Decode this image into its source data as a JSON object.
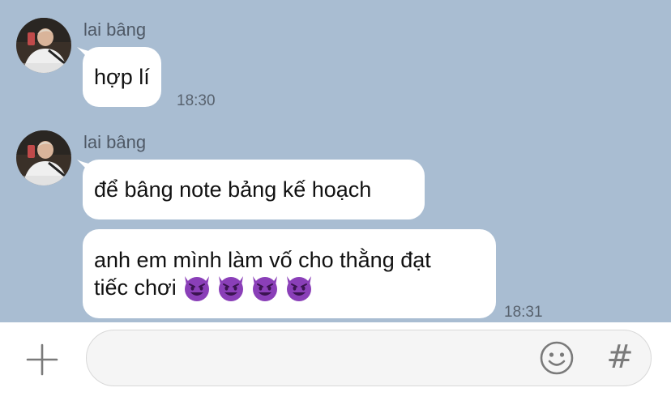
{
  "messages": [
    {
      "sender": "lai bâng",
      "avatar_icon": "user-photo-avatar",
      "bubbles": [
        {
          "text": "hợp lí",
          "time": "18:30"
        }
      ]
    },
    {
      "sender": "lai bâng",
      "avatar_icon": "user-photo-avatar",
      "bubbles": [
        {
          "text": "để bâng note bảng kế hoạch"
        },
        {
          "line1": "anh em mình làm vố cho thằng đạt",
          "line2": "tiếc chơi",
          "emoji": "smiling-devil-emoji",
          "emoji_count": 4,
          "time": "18:31"
        }
      ]
    }
  ],
  "composer": {
    "input_value": "",
    "input_placeholder": "",
    "plus_icon": "plus-icon",
    "emoji_icon": "smiley-icon",
    "hash_label": "#"
  },
  "colors": {
    "chat_background": "#a9bdd2",
    "bubble": "#ffffff",
    "emoji_purple": "#8a3fb8"
  }
}
